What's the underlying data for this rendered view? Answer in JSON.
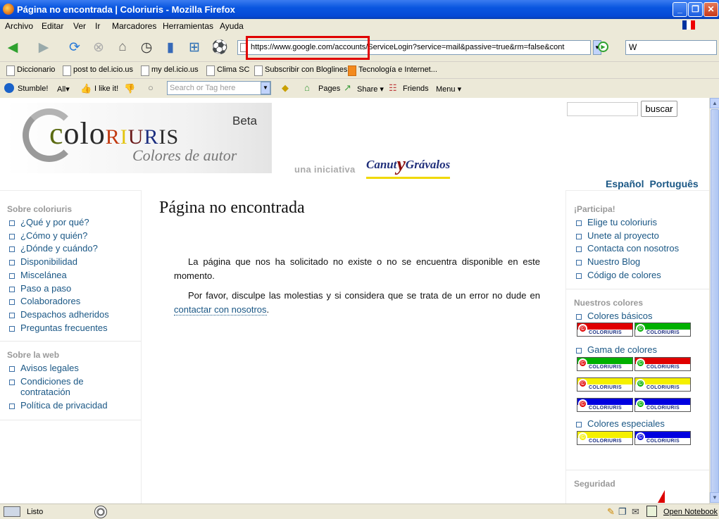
{
  "window": {
    "title": "Página no encontrada | Coloriuris - Mozilla Firefox",
    "minimize": "_",
    "maximize": "❐",
    "close": "✕"
  },
  "menubar": [
    "Archivo",
    "Editar",
    "Ver",
    "Ir",
    "Marcadores",
    "Herramientas",
    "Ayuda"
  ],
  "navbar": {
    "url": "https://www.google.com/accounts/ServiceLogin?service=mail&passive=true&rm=false&cont",
    "search_placeholder": "W"
  },
  "bookmarks": [
    "Diccionario",
    "post to del.icio.us",
    "my del.icio.us",
    "Clima SC",
    "Subscribir con Bloglines",
    "Tecnología e Internet..."
  ],
  "stumble": {
    "stumble": "Stumble!",
    "all": "All▾",
    "ilike": "I like it!",
    "tag_placeholder": "Search or Tag here",
    "pages": "Pages",
    "share": "Share ▾",
    "friends": "Friends",
    "menu": "Menu ▾"
  },
  "header": {
    "logo_word": "coloriuris",
    "logo_beta": "Beta",
    "logo_tag": "Colores de autor",
    "iniciativa": "una iniciativa",
    "canut_a": "Canut",
    "canut_y": "y",
    "canut_b": "Grávalos",
    "search_button": "buscar",
    "lang_es": "Español",
    "lang_pt": "Português"
  },
  "left": {
    "sec1": "Sobre coloriuris",
    "sec1_items": [
      "¿Qué y por qué?",
      "¿Cómo y quién?",
      "¿Dónde y cuándo?",
      "Disponibilidad",
      "Miscelánea",
      "Paso a paso",
      "Colaboradores",
      "Despachos adheridos",
      "Preguntas frecuentes"
    ],
    "sec2": "Sobre la web",
    "sec2_items": [
      "Avisos legales",
      "Condiciones de contratación",
      "Política de privacidad"
    ]
  },
  "main": {
    "title": "Página no encontrada",
    "p1": "La página que nos ha solicitado no existe o no se encuentra disponible en este momento.",
    "p2_pre": "Por favor, disculpe las molestias y si considera que se trata de un error no dude en ",
    "p2_link": "contactar con nosotros",
    "p2_post": "."
  },
  "right": {
    "sec1": "¡Participa!",
    "sec1_items": [
      "Elige tu coloriuris",
      "Unete al proyecto",
      "Contacta con nosotros",
      "Nuestro Blog",
      "Código de colores"
    ],
    "sec2": "Nuestros colores",
    "basicos": "Colores básicos",
    "gama": "Gama de colores",
    "especiales": "Colores especiales",
    "badge_text": "COLORIURIS",
    "badge_symbol": "©",
    "sec3": "Seguridad",
    "colors": {
      "red": "#e00000",
      "green": "#00b000",
      "yellow": "#f5f000",
      "blue": "#0000e0"
    }
  },
  "status": {
    "text": "Listo",
    "open_notebook": "Open Notebook"
  }
}
